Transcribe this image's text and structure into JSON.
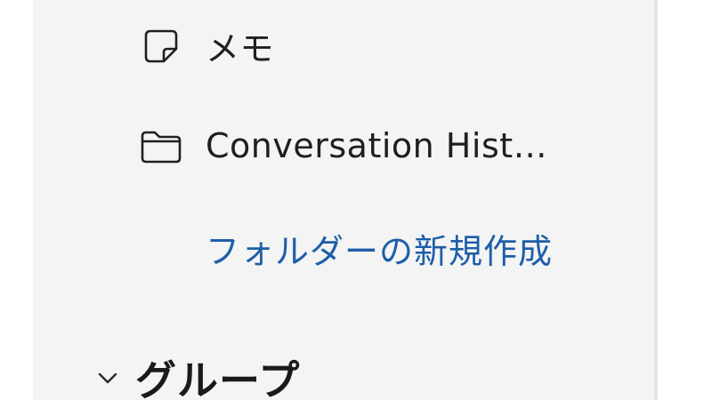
{
  "folders": {
    "items": [
      {
        "icon": "sticky-note-icon",
        "label": "メモ"
      },
      {
        "icon": "folder-icon",
        "label": "Conversation Hist…"
      }
    ],
    "new_folder_label": "フォルダーの新規作成"
  },
  "groups": {
    "icon": "chevron-down-icon",
    "label": "グループ"
  },
  "colors": {
    "pane_background": "#f4f4f4",
    "link": "#1d5ea8",
    "text": "#1f1f1f"
  }
}
